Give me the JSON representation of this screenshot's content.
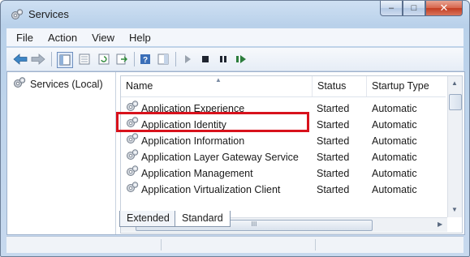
{
  "window": {
    "title": "Services",
    "app_icon": "gear-services-icon",
    "controls": {
      "minimize_icon": "minimize-icon",
      "maximize_icon": "maximize-icon",
      "close_icon": "close-icon",
      "close_glyph": "✕",
      "minimize_glyph": "–",
      "maximize_glyph": "□"
    }
  },
  "menu": [
    "File",
    "Action",
    "View",
    "Help"
  ],
  "toolbar": {
    "icons": [
      "back-arrow-icon",
      "forward-arrow-icon",
      "show-console-tree-icon",
      "properties-icon",
      "refresh-icon",
      "export-list-icon",
      "help-icon",
      "show-hide-action-pane-icon",
      "start-service-icon",
      "stop-service-icon",
      "pause-service-icon",
      "restart-service-icon"
    ]
  },
  "tree": {
    "label": "Services (Local)",
    "icon": "gear-services-icon"
  },
  "list": {
    "columns": [
      "Name",
      "Status",
      "Startup Type"
    ],
    "rows": [
      {
        "name": "Application Experience",
        "status": "Started",
        "startup": "Automatic"
      },
      {
        "name": "Application Identity",
        "status": "Started",
        "startup": "Automatic"
      },
      {
        "name": "Application Information",
        "status": "Started",
        "startup": "Automatic"
      },
      {
        "name": "Application Layer Gateway Service",
        "status": "Started",
        "startup": "Automatic"
      },
      {
        "name": "Application Management",
        "status": "Started",
        "startup": "Automatic"
      },
      {
        "name": "Application Virtualization Client",
        "status": "Started",
        "startup": "Automatic"
      }
    ],
    "highlighted_row": "Application Identity",
    "highlight_color": "#d8121c",
    "hscroll_grip": "III"
  },
  "tabs": [
    "Extended",
    "Standard"
  ],
  "active_tab": "Standard"
}
